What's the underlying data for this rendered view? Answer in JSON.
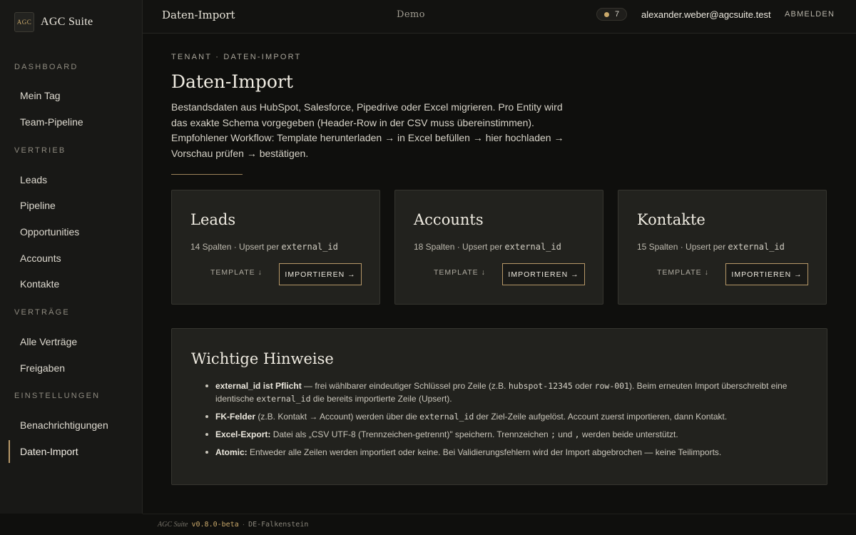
{
  "app": {
    "logo_text": "AGC",
    "name": "AGC Suite"
  },
  "sidebar": {
    "sections": [
      {
        "title": "DASHBOARD",
        "items": [
          "Mein Tag",
          "Team-Pipeline"
        ]
      },
      {
        "title": "VERTRIEB",
        "items": [
          "Leads",
          "Pipeline",
          "Opportunities",
          "Accounts",
          "Kontakte"
        ]
      },
      {
        "title": "VERTRÄGE",
        "items": [
          "Alle Verträge",
          "Freigaben"
        ]
      },
      {
        "title": "EINSTELLUNGEN",
        "items": [
          "Benachrichtigungen",
          "Daten-Import"
        ]
      }
    ],
    "active_item": "Daten-Import"
  },
  "topbar": {
    "page": "Daten-Import",
    "environment": "Demo",
    "notifications_count": "7",
    "user_email": "alexander.weber@agcsuite.test",
    "logout": "ABMELDEN"
  },
  "main": {
    "breadcrumb": "TENANT · DATEN-IMPORT",
    "title": "Daten-Import",
    "intro": "Bestandsdaten aus HubSpot, Salesforce, Pipedrive oder Excel migrieren. Pro Entity wird das exakte Schema vorgegeben (Header-Row in der CSV muss übereinstimmen). Empfohlener Workflow: Template herunterladen → in Excel befüllen → hier hochladen → Vorschau prüfen → bestätigen.",
    "cards": [
      {
        "title": "Leads",
        "columns": "14 Spalten · Upsert per ",
        "key": "external_id",
        "template": "TEMPLATE ↓",
        "import": "IMPORTIEREN →"
      },
      {
        "title": "Accounts",
        "columns": "18 Spalten · Upsert per ",
        "key": "external_id",
        "template": "TEMPLATE ↓",
        "import": "IMPORTIEREN →"
      },
      {
        "title": "Kontakte",
        "columns": "15 Spalten · Upsert per ",
        "key": "external_id",
        "template": "TEMPLATE ↓",
        "import": "IMPORTIEREN →"
      }
    ]
  },
  "notes": {
    "title": "Wichtige Hinweise",
    "items": [
      {
        "bold": "external_id ist Pflicht",
        "parts": [
          " — frei wählbarer eindeutiger Schlüssel pro Zeile (z.B. ",
          "hubspot-12345",
          " oder ",
          "row-001",
          "). Beim erneuten Import überschreibt eine identische ",
          "external_id",
          " die bereits importierte Zeile (Upsert)."
        ]
      },
      {
        "bold": "FK-Felder",
        "parts": [
          " (z.B. Kontakt → Account) werden über die ",
          "external_id",
          " der Ziel-Zeile aufgelöst. Account zuerst importieren, dann Kontakt."
        ]
      },
      {
        "bold": "Excel-Export:",
        "parts": [
          " Datei als „CSV UTF-8 (Trennzeichen-getrennt)\" speichern. Trennzeichen ",
          ";",
          " und ",
          ",",
          " werden beide unterstützt."
        ]
      },
      {
        "bold": "Atomic:",
        "parts": [
          " Entweder alle Zeilen werden importiert oder keine. Bei Validierungsfehlern wird der Import abgebrochen — keine Teilimports."
        ]
      }
    ]
  },
  "footer": {
    "brand": "AGC Suite",
    "version": "v0.8.0-beta",
    "separator": "·",
    "region": "DE-Falkenstein"
  },
  "colors": {
    "accent": "#b79868",
    "background": "#0f0f0d",
    "card": "#22221e"
  }
}
